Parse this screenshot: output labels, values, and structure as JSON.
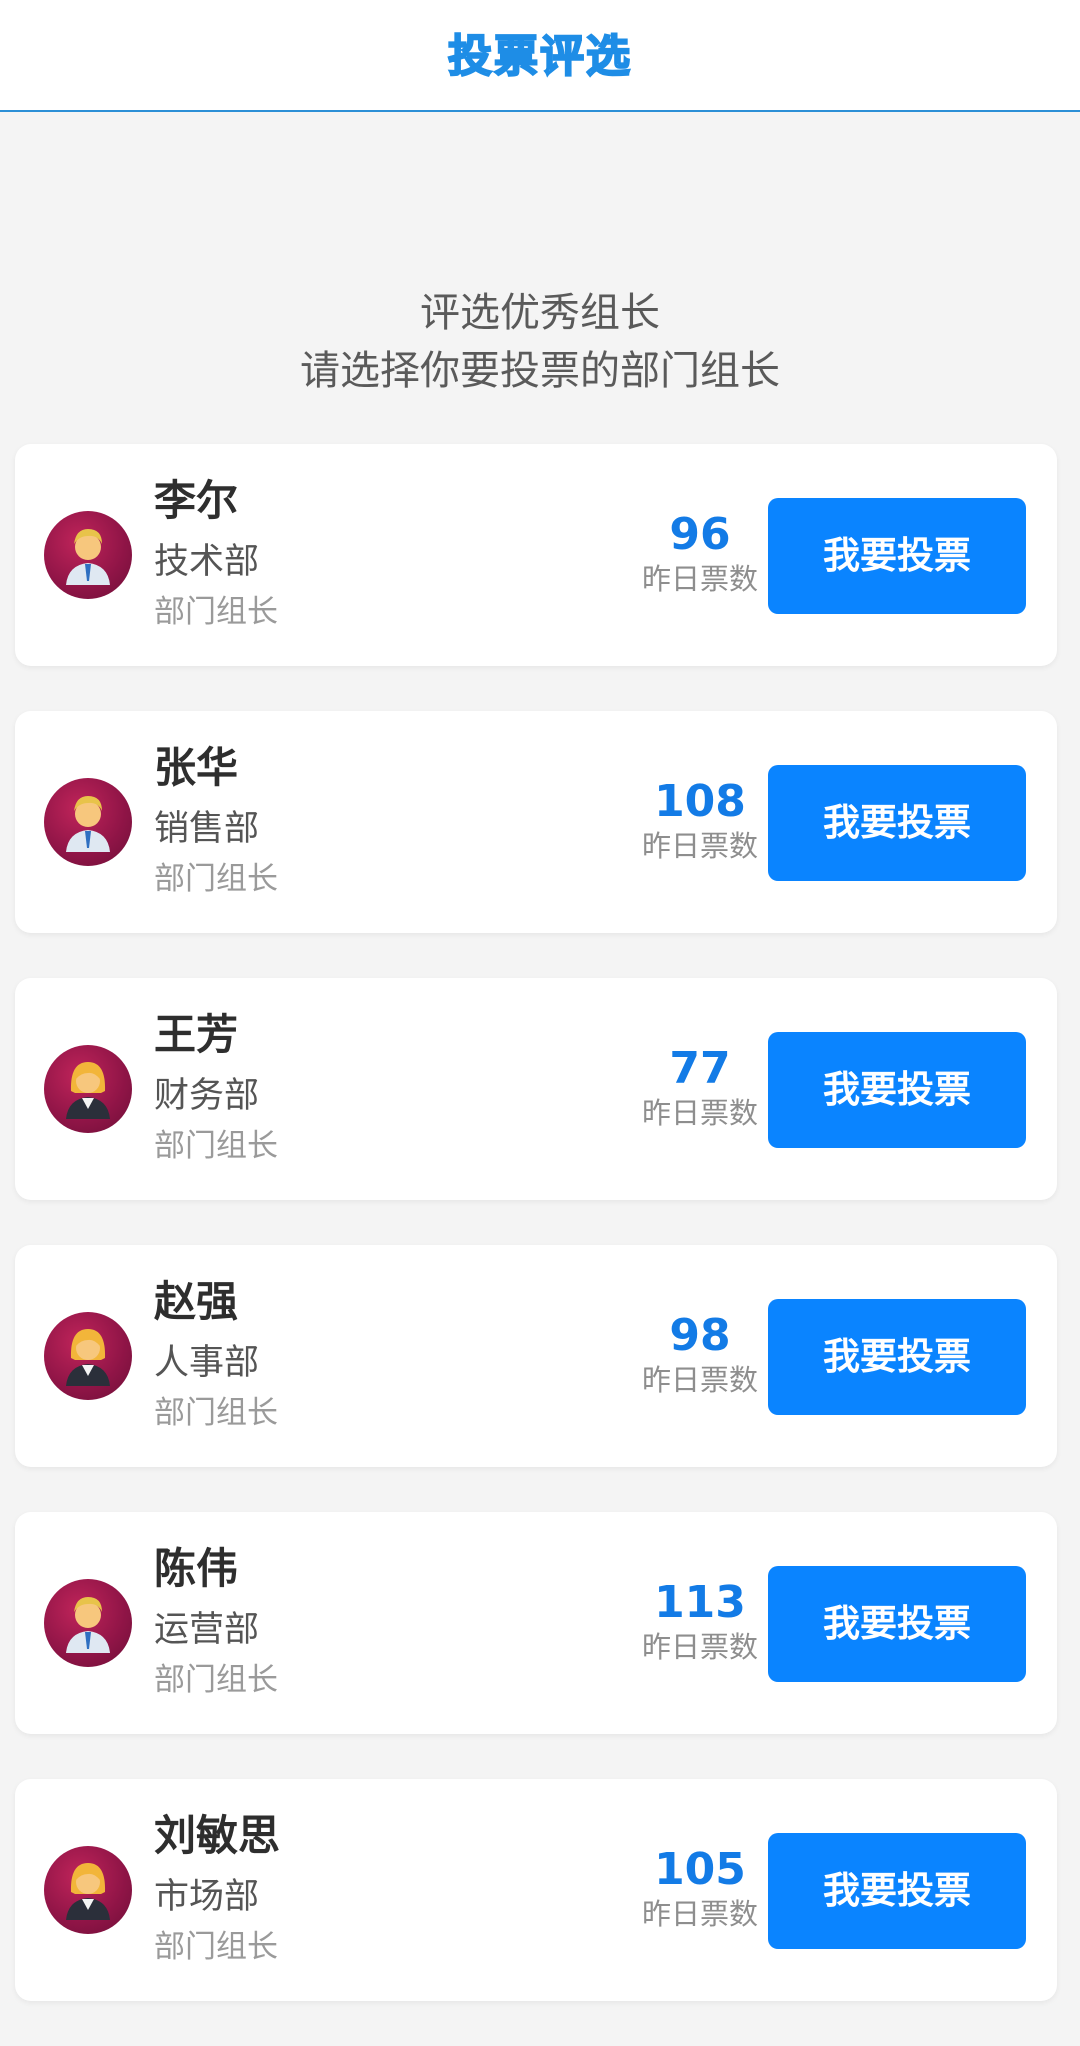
{
  "header": {
    "title": "投票评选"
  },
  "intro": {
    "line1": "评选优秀组长",
    "line2": "请选择你要投票的部门组长"
  },
  "candidates": [
    {
      "name": "李尔",
      "dept": "技术部",
      "role": "部门组长",
      "votes": "96",
      "votes_label": "昨日票数",
      "button": "我要投票",
      "avatar_icon": "man-office-worker-icon"
    },
    {
      "name": "张华",
      "dept": "销售部",
      "role": "部门组长",
      "votes": "108",
      "votes_label": "昨日票数",
      "button": "我要投票",
      "avatar_icon": "man-office-worker-icon"
    },
    {
      "name": "王芳",
      "dept": "财务部",
      "role": "部门组长",
      "votes": "77",
      "votes_label": "昨日票数",
      "button": "我要投票",
      "avatar_icon": "woman-office-worker-icon"
    },
    {
      "name": "赵强",
      "dept": "人事部",
      "role": "部门组长",
      "votes": "98",
      "votes_label": "昨日票数",
      "button": "我要投票",
      "avatar_icon": "woman-office-worker-icon"
    },
    {
      "name": "陈伟",
      "dept": "运营部",
      "role": "部门组长",
      "votes": "113",
      "votes_label": "昨日票数",
      "button": "我要投票",
      "avatar_icon": "man-office-worker-icon"
    },
    {
      "name": "刘敏思",
      "dept": "市场部",
      "role": "部门组长",
      "votes": "105",
      "votes_label": "昨日票数",
      "button": "我要投票",
      "avatar_icon": "woman-office-worker-icon"
    }
  ],
  "colors": {
    "accent": "#0a84ff",
    "vote_count": "#137be6",
    "header_border": "#2c8fd6",
    "avatar_bg": "#8e1446",
    "page_bg": "#f4f4f4"
  }
}
